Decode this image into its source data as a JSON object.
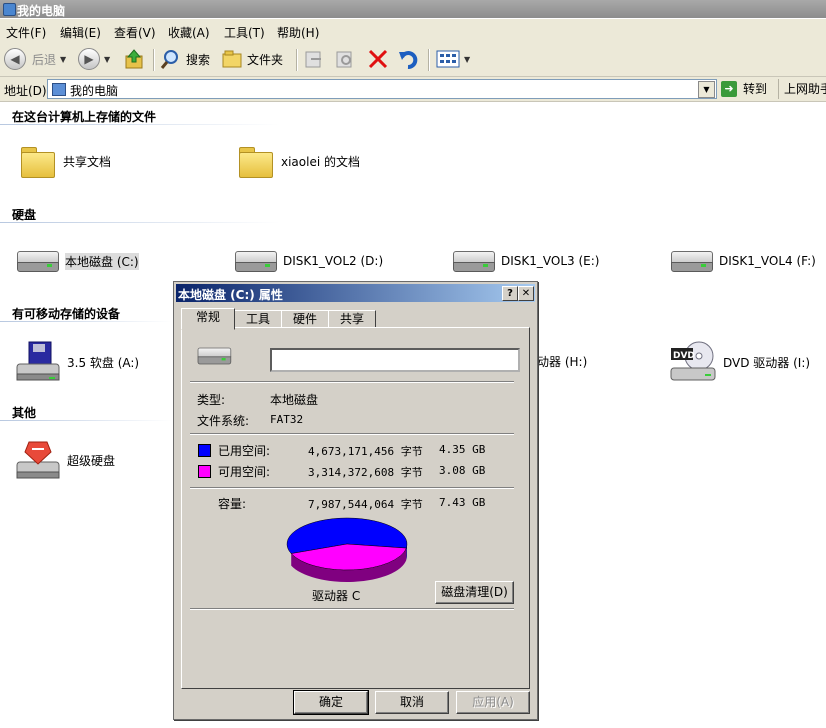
{
  "window": {
    "title": "我的电脑"
  },
  "menu": [
    "文件(F)",
    "编辑(E)",
    "查看(V)",
    "收藏(A)",
    "工具(T)",
    "帮助(H)"
  ],
  "toolbar": {
    "back": "后退",
    "search": "搜索",
    "folders": "文件夹"
  },
  "address": {
    "label": "地址(D)",
    "value": "我的电脑",
    "go": "转到",
    "links": "上网助手"
  },
  "groups": {
    "files": {
      "title": "在这台计算机上存储的文件",
      "items": [
        "共享文档",
        "xiaolei 的文档"
      ]
    },
    "hdd": {
      "title": "硬盘",
      "items": [
        "本地磁盘 (C:)",
        "DISK1_VOL2 (D:)",
        "DISK1_VOL3 (E:)",
        "DISK1_VOL4 (F:)"
      ]
    },
    "removable": {
      "title": "有可移动存储的设备",
      "items": [
        "3.5 软盘 (A:)",
        "动器 (H:)",
        "DVD 驱动器 (I:)"
      ]
    },
    "other": {
      "title": "其他",
      "items": [
        "超级硬盘"
      ]
    }
  },
  "dialog": {
    "title": "本地磁盘 (C:) 属性",
    "help_btn": "?",
    "close_btn": "✕",
    "tabs": [
      "常规",
      "工具",
      "硬件",
      "共享"
    ],
    "name_value": "",
    "type_label": "类型:",
    "type_value": "本地磁盘",
    "fs_label": "文件系统:",
    "fs_value": "FAT32",
    "used_label": "已用空间:",
    "used_bytes": "4,673,171,456 字节",
    "used_gb": "4.35 GB",
    "free_label": "可用空间:",
    "free_bytes": "3,314,372,608 字节",
    "free_gb": "3.08 GB",
    "cap_label": "容量:",
    "cap_bytes": "7,987,544,064 字节",
    "cap_gb": "7.43 GB",
    "drive_label": "驱动器 C",
    "cleanup_btn": "磁盘清理(D)",
    "ok": "确定",
    "cancel": "取消",
    "apply": "应用(A)",
    "colors": {
      "used": "#0000ff",
      "free": "#ff00ff"
    },
    "used_fraction": 0.585
  }
}
